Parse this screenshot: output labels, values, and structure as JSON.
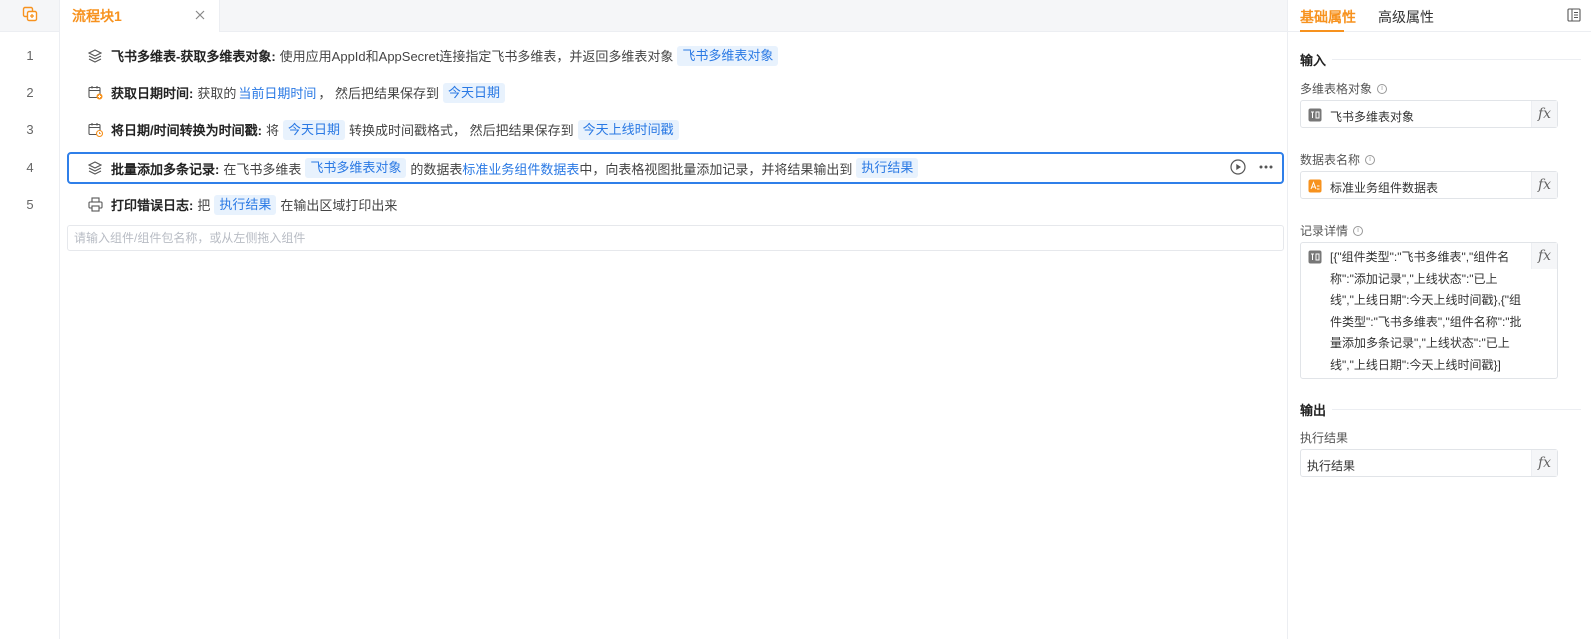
{
  "tabs": [
    {
      "label": "流程块1"
    }
  ],
  "rows": [
    {
      "num": "1",
      "title": "飞书多维表-获取多维表对象:",
      "t1": "使用应用AppId和AppSecret连接指定飞书多维表，并返回多维表对象",
      "chip1": "飞书多维表对象"
    },
    {
      "num": "2",
      "title": "获取日期时间:",
      "t1": "获取的",
      "link1": "当前日期时间",
      "t2": "， 然后把结果保存到",
      "chip1": "今天日期"
    },
    {
      "num": "3",
      "title": "将日期/时间转换为时间戳:",
      "t1": "将",
      "chip1": "今天日期",
      "t2": "转换成时间戳格式， 然后把结果保存到",
      "chip2": "今天上线时间戳"
    },
    {
      "num": "4",
      "title": "批量添加多条记录:",
      "t1": "在飞书多维表",
      "chip1": "飞书多维表对象",
      "t2": "的数据表",
      "link1": "标准业务组件数据表",
      "t3": "中，向表格视图批量添加记录，并将结果输出到",
      "chip2": "执行结果"
    },
    {
      "num": "5",
      "title": "打印错误日志:",
      "t1": "把",
      "chip1": "执行结果",
      "t2": "在输出区域打印出来"
    }
  ],
  "command_input": {
    "placeholder": "请输入组件/组件包名称，或从左侧拖入组件"
  },
  "panel": {
    "tab_basic": "基础属性",
    "tab_advanced": "高级属性",
    "input_section": "输入",
    "output_section": "输出",
    "fields": {
      "table_object": {
        "label": "多维表格对象",
        "value": "飞书多维表对象"
      },
      "sheet_name": {
        "label": "数据表名称",
        "value": "标准业务组件数据表"
      },
      "record_detail": {
        "label": "记录详情",
        "value": "[{\"组件类型\":\"飞书多维表\",\"组件名称\":\"添加记录\",\"上线状态\":\"已上线\",\"上线日期\":今天上线时间戳},{\"组件类型\":\"飞书多维表\",\"组件名称\":\"批量添加多条记录\",\"上线状态\":\"已上线\",\"上线日期\":今天上线时间戳}]"
      },
      "exec_result": {
        "label": "执行结果",
        "value": "执行结果"
      }
    },
    "fx_label": "fx"
  },
  "colors": {
    "accent": "#f7921e",
    "selection": "#2f7fe9",
    "chip_bg": "#e8f2fd",
    "chip_text": "#2a79e4"
  },
  "icons": {
    "gutter_top": "flow-block-icon",
    "row1": "layers-icon",
    "row2": "calendar-add-icon",
    "row3": "calendar-clock-icon",
    "row4": "layers-icon",
    "row5": "printer-icon",
    "run": "play-circle-icon",
    "more": "more-icon",
    "close": "close-icon",
    "panel_toggle": "panel-collapse-icon",
    "table_field": "table-object-icon",
    "sheet_field": "text-variable-icon"
  }
}
